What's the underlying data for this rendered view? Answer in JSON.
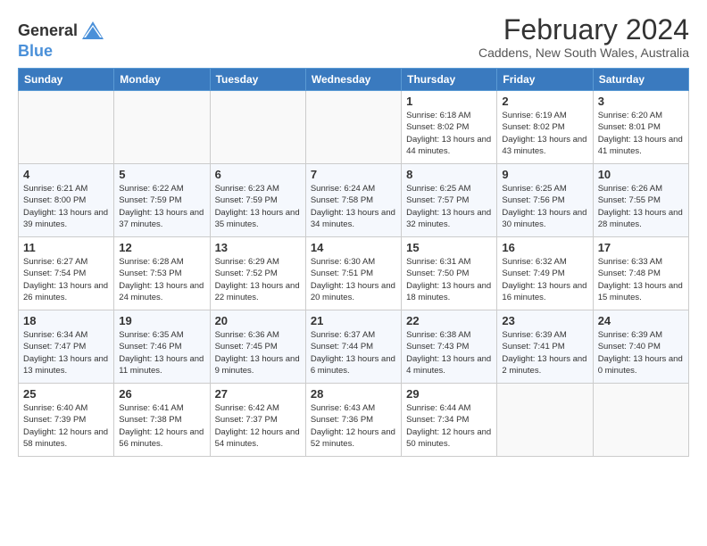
{
  "header": {
    "logo": {
      "general": "General",
      "blue": "Blue"
    },
    "title": "February 2024",
    "location": "Caddens, New South Wales, Australia"
  },
  "weekdays": [
    "Sunday",
    "Monday",
    "Tuesday",
    "Wednesday",
    "Thursday",
    "Friday",
    "Saturday"
  ],
  "weeks": [
    [
      {
        "day": null,
        "info": null
      },
      {
        "day": null,
        "info": null
      },
      {
        "day": null,
        "info": null
      },
      {
        "day": null,
        "info": null
      },
      {
        "day": "1",
        "sunrise": "6:18 AM",
        "sunset": "8:02 PM",
        "daylight": "13 hours and 44 minutes."
      },
      {
        "day": "2",
        "sunrise": "6:19 AM",
        "sunset": "8:02 PM",
        "daylight": "13 hours and 43 minutes."
      },
      {
        "day": "3",
        "sunrise": "6:20 AM",
        "sunset": "8:01 PM",
        "daylight": "13 hours and 41 minutes."
      }
    ],
    [
      {
        "day": "4",
        "sunrise": "6:21 AM",
        "sunset": "8:00 PM",
        "daylight": "13 hours and 39 minutes."
      },
      {
        "day": "5",
        "sunrise": "6:22 AM",
        "sunset": "7:59 PM",
        "daylight": "13 hours and 37 minutes."
      },
      {
        "day": "6",
        "sunrise": "6:23 AM",
        "sunset": "7:59 PM",
        "daylight": "13 hours and 35 minutes."
      },
      {
        "day": "7",
        "sunrise": "6:24 AM",
        "sunset": "7:58 PM",
        "daylight": "13 hours and 34 minutes."
      },
      {
        "day": "8",
        "sunrise": "6:25 AM",
        "sunset": "7:57 PM",
        "daylight": "13 hours and 32 minutes."
      },
      {
        "day": "9",
        "sunrise": "6:25 AM",
        "sunset": "7:56 PM",
        "daylight": "13 hours and 30 minutes."
      },
      {
        "day": "10",
        "sunrise": "6:26 AM",
        "sunset": "7:55 PM",
        "daylight": "13 hours and 28 minutes."
      }
    ],
    [
      {
        "day": "11",
        "sunrise": "6:27 AM",
        "sunset": "7:54 PM",
        "daylight": "13 hours and 26 minutes."
      },
      {
        "day": "12",
        "sunrise": "6:28 AM",
        "sunset": "7:53 PM",
        "daylight": "13 hours and 24 minutes."
      },
      {
        "day": "13",
        "sunrise": "6:29 AM",
        "sunset": "7:52 PM",
        "daylight": "13 hours and 22 minutes."
      },
      {
        "day": "14",
        "sunrise": "6:30 AM",
        "sunset": "7:51 PM",
        "daylight": "13 hours and 20 minutes."
      },
      {
        "day": "15",
        "sunrise": "6:31 AM",
        "sunset": "7:50 PM",
        "daylight": "13 hours and 18 minutes."
      },
      {
        "day": "16",
        "sunrise": "6:32 AM",
        "sunset": "7:49 PM",
        "daylight": "13 hours and 16 minutes."
      },
      {
        "day": "17",
        "sunrise": "6:33 AM",
        "sunset": "7:48 PM",
        "daylight": "13 hours and 15 minutes."
      }
    ],
    [
      {
        "day": "18",
        "sunrise": "6:34 AM",
        "sunset": "7:47 PM",
        "daylight": "13 hours and 13 minutes."
      },
      {
        "day": "19",
        "sunrise": "6:35 AM",
        "sunset": "7:46 PM",
        "daylight": "13 hours and 11 minutes."
      },
      {
        "day": "20",
        "sunrise": "6:36 AM",
        "sunset": "7:45 PM",
        "daylight": "13 hours and 9 minutes."
      },
      {
        "day": "21",
        "sunrise": "6:37 AM",
        "sunset": "7:44 PM",
        "daylight": "13 hours and 6 minutes."
      },
      {
        "day": "22",
        "sunrise": "6:38 AM",
        "sunset": "7:43 PM",
        "daylight": "13 hours and 4 minutes."
      },
      {
        "day": "23",
        "sunrise": "6:39 AM",
        "sunset": "7:41 PM",
        "daylight": "13 hours and 2 minutes."
      },
      {
        "day": "24",
        "sunrise": "6:39 AM",
        "sunset": "7:40 PM",
        "daylight": "13 hours and 0 minutes."
      }
    ],
    [
      {
        "day": "25",
        "sunrise": "6:40 AM",
        "sunset": "7:39 PM",
        "daylight": "12 hours and 58 minutes."
      },
      {
        "day": "26",
        "sunrise": "6:41 AM",
        "sunset": "7:38 PM",
        "daylight": "12 hours and 56 minutes."
      },
      {
        "day": "27",
        "sunrise": "6:42 AM",
        "sunset": "7:37 PM",
        "daylight": "12 hours and 54 minutes."
      },
      {
        "day": "28",
        "sunrise": "6:43 AM",
        "sunset": "7:36 PM",
        "daylight": "12 hours and 52 minutes."
      },
      {
        "day": "29",
        "sunrise": "6:44 AM",
        "sunset": "7:34 PM",
        "daylight": "12 hours and 50 minutes."
      },
      {
        "day": null,
        "info": null
      },
      {
        "day": null,
        "info": null
      }
    ]
  ]
}
